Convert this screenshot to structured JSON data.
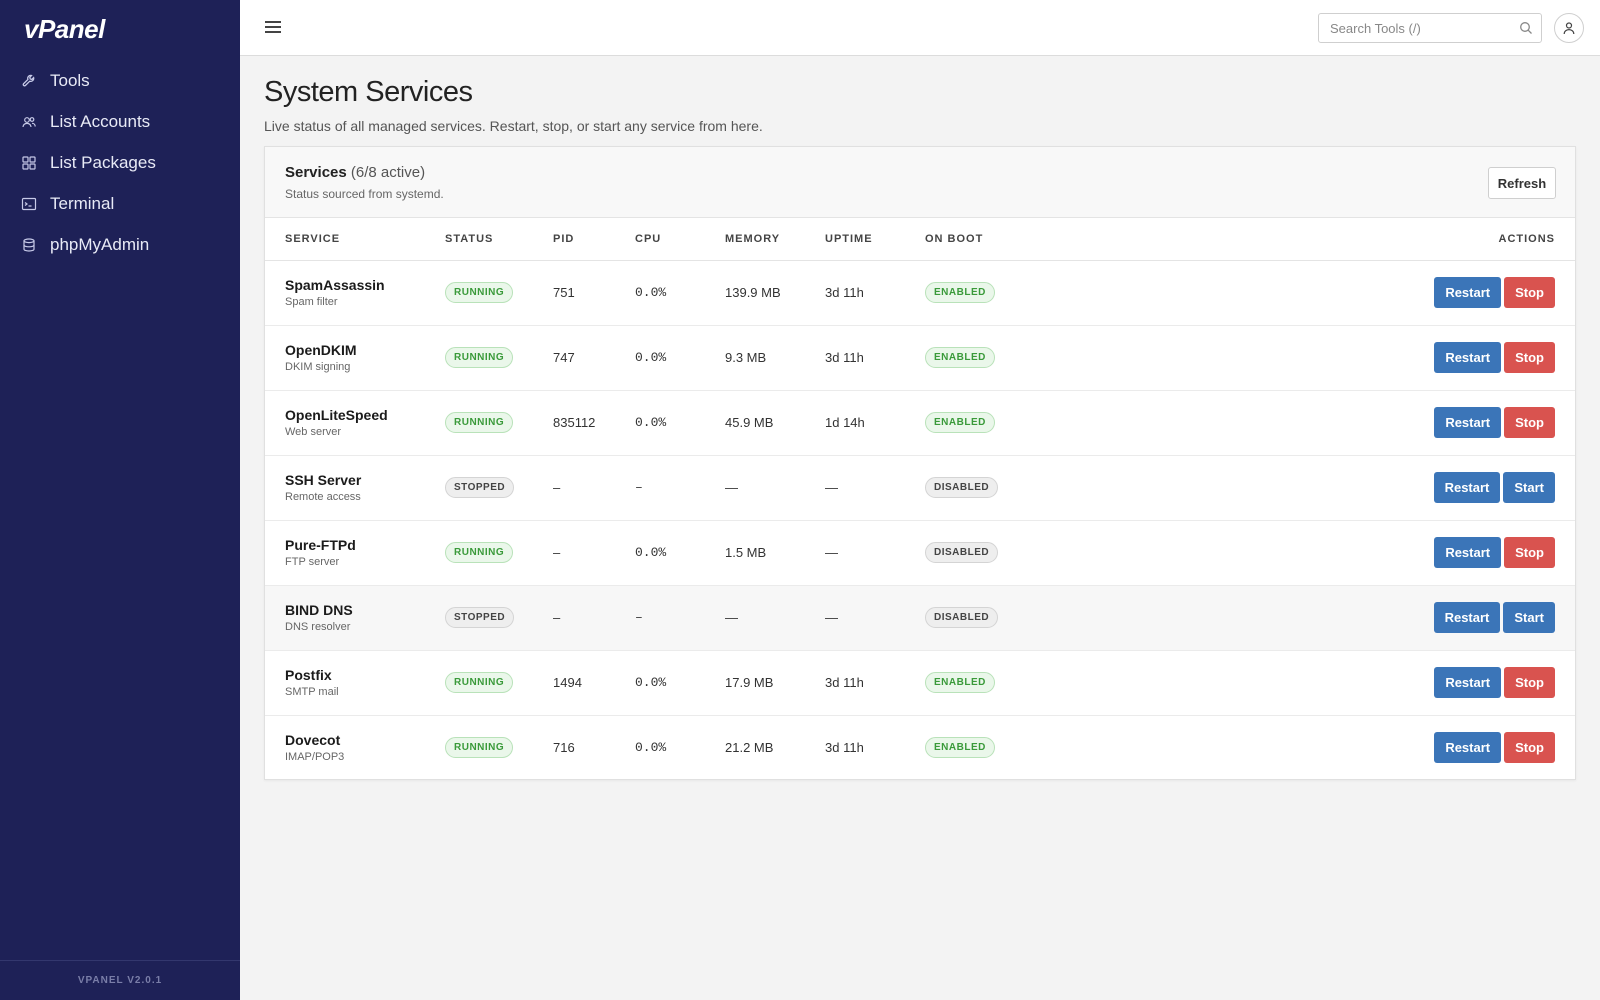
{
  "app": {
    "logo": "vPanel",
    "version": "VPANEL V2.0.1"
  },
  "sidebar": {
    "items": [
      {
        "label": "Tools",
        "icon": "wrench-icon"
      },
      {
        "label": "List Accounts",
        "icon": "users-icon"
      },
      {
        "label": "List Packages",
        "icon": "grid-icon"
      },
      {
        "label": "Terminal",
        "icon": "terminal-icon"
      },
      {
        "label": "phpMyAdmin",
        "icon": "database-icon"
      }
    ]
  },
  "topbar": {
    "search_placeholder": "Search Tools (/)"
  },
  "page": {
    "title": "System Services",
    "subtitle": "Live status of all managed services. Restart, stop, or start any service from here."
  },
  "card": {
    "title": "Services",
    "count": "(6/8 active)",
    "description": "Status sourced from systemd.",
    "refresh_label": "Refresh"
  },
  "table": {
    "headers": [
      "SERVICE",
      "STATUS",
      "PID",
      "CPU",
      "MEMORY",
      "UPTIME",
      "ON BOOT",
      "ACTIONS"
    ],
    "rows": [
      {
        "name": "SpamAssassin",
        "desc": "Spam filter",
        "status": "RUNNING",
        "pid": "751",
        "cpu": "0.0%",
        "memory": "139.9 MB",
        "uptime": "3d 11h",
        "boot": "ENABLED",
        "primary": "Restart",
        "secondary": "Stop"
      },
      {
        "name": "OpenDKIM",
        "desc": "DKIM signing",
        "status": "RUNNING",
        "pid": "747",
        "cpu": "0.0%",
        "memory": "9.3 MB",
        "uptime": "3d 11h",
        "boot": "ENABLED",
        "primary": "Restart",
        "secondary": "Stop"
      },
      {
        "name": "OpenLiteSpeed",
        "desc": "Web server",
        "status": "RUNNING",
        "pid": "835112",
        "cpu": "0.0%",
        "memory": "45.9 MB",
        "uptime": "1d 14h",
        "boot": "ENABLED",
        "primary": "Restart",
        "secondary": "Stop"
      },
      {
        "name": "SSH Server",
        "desc": "Remote access",
        "status": "STOPPED",
        "pid": "–",
        "cpu": "–",
        "memory": "—",
        "uptime": "—",
        "boot": "DISABLED",
        "primary": "Restart",
        "secondary": "Start"
      },
      {
        "name": "Pure-FTPd",
        "desc": "FTP server",
        "status": "RUNNING",
        "pid": "–",
        "cpu": "0.0%",
        "memory": "1.5 MB",
        "uptime": "—",
        "boot": "DISABLED",
        "primary": "Restart",
        "secondary": "Stop"
      },
      {
        "name": "BIND DNS",
        "desc": "DNS resolver",
        "status": "STOPPED",
        "pid": "–",
        "cpu": "–",
        "memory": "—",
        "uptime": "—",
        "boot": "DISABLED",
        "primary": "Restart",
        "secondary": "Start"
      },
      {
        "name": "Postfix",
        "desc": "SMTP mail",
        "status": "RUNNING",
        "pid": "1494",
        "cpu": "0.0%",
        "memory": "17.9 MB",
        "uptime": "3d 11h",
        "boot": "ENABLED",
        "primary": "Restart",
        "secondary": "Stop"
      },
      {
        "name": "Dovecot",
        "desc": "IMAP/POP3",
        "status": "RUNNING",
        "pid": "716",
        "cpu": "0.0%",
        "memory": "21.2 MB",
        "uptime": "3d 11h",
        "boot": "ENABLED",
        "primary": "Restart",
        "secondary": "Stop"
      }
    ]
  },
  "colors": {
    "sidebar_bg": "#1e2157",
    "primary_button": "#3b75b8",
    "danger_button": "#d9534f",
    "running_badge": "#3a9a3a"
  }
}
